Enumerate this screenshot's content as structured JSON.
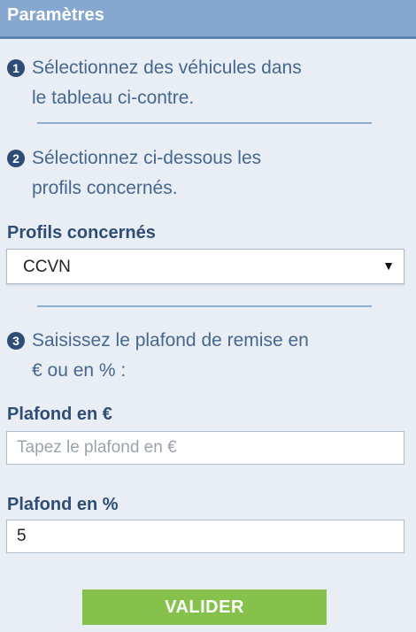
{
  "header": {
    "title": "Paramètres"
  },
  "steps": [
    {
      "number": "1",
      "text_line1": "Sélectionnez des véhicules dans",
      "text_line2": "le tableau ci-contre."
    },
    {
      "number": "2",
      "text_line1": "Sélectionnez ci-dessous les",
      "text_line2": "profils concernés."
    },
    {
      "number": "3",
      "text_line1": "Saisissez le plafond de remise en",
      "text_line2": "€ ou en % :"
    }
  ],
  "profils": {
    "label": "Profils concernés",
    "selected": "CCVN"
  },
  "plafond_euro": {
    "label": "Plafond en €",
    "value": "",
    "placeholder": "Tapez le plafond en €"
  },
  "plafond_pct": {
    "label": "Plafond en %",
    "value": "5"
  },
  "valider_label": "VALIDER",
  "colors": {
    "header": "#86a7cf",
    "accent_button": "#86c24b",
    "panel_background": "#e9eef5"
  }
}
